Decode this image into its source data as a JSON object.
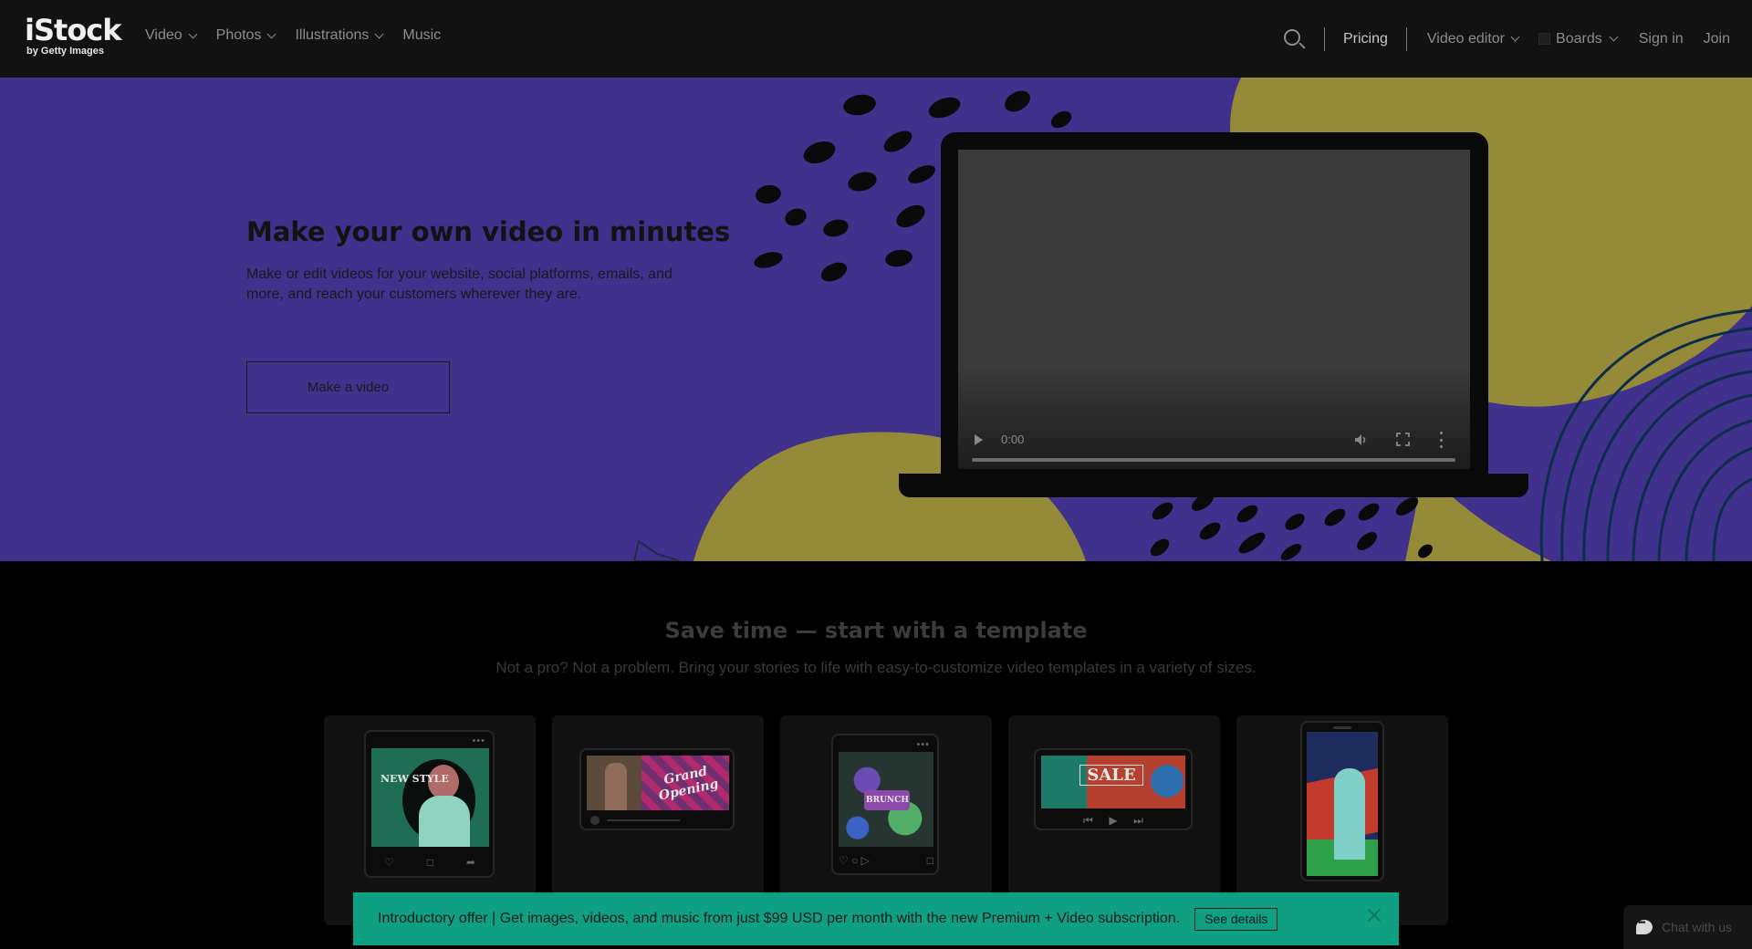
{
  "nav": {
    "logo_main": "iStock",
    "logo_sub": "by Getty Images",
    "items": [
      {
        "label": "Video",
        "has_menu": true
      },
      {
        "label": "Photos",
        "has_menu": true
      },
      {
        "label": "Illustrations",
        "has_menu": true
      },
      {
        "label": "Music",
        "has_menu": false
      }
    ],
    "search_icon": "search-icon",
    "pricing": "Pricing",
    "video_editor": "Video editor",
    "boards": "Boards",
    "sign_in": "Sign in",
    "join": "Join"
  },
  "hero": {
    "title": "Make your own video in minutes",
    "description": "Make or edit videos for your website, social platforms, emails, and more, and reach your customers wherever they are.",
    "cta": "Make a video",
    "colors": {
      "background": "#3f318c",
      "accent": "#958a38"
    },
    "video": {
      "time": "0:00",
      "progress": 0
    }
  },
  "templates": {
    "title": "Save time — start with a template",
    "subtitle": "Not a pro? Not a problem. Bring your stories to life with easy-to-customize video templates in a variety of sizes.",
    "cards": [
      {
        "format": "social-post",
        "overlay_text": "NEW STYLE"
      },
      {
        "format": "widescreen",
        "overlay_text": "Grand Opening"
      },
      {
        "format": "social-post",
        "overlay_text": "BRUNCH"
      },
      {
        "format": "player",
        "overlay_text": "SALE"
      },
      {
        "format": "story",
        "overlay_text": ""
      }
    ]
  },
  "promo": {
    "text": "Introductory offer | Get images, videos, and music from just $99 USD per month with the new Premium + Video subscription.",
    "button": "See details",
    "color": "#0fa084"
  },
  "chat": {
    "label": "Chat with us"
  }
}
